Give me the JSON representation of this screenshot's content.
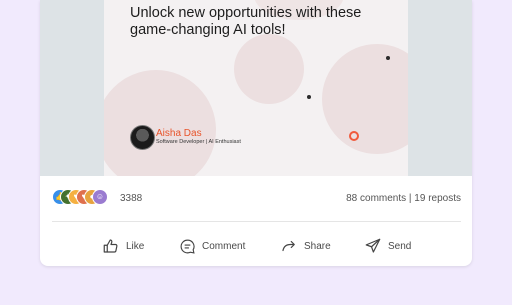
{
  "post": {
    "headline": "Unlock new opportunities with these game-changing AI tools!",
    "author": {
      "name": "Aisha Das",
      "role": "Software Developer | AI Enthusiast"
    }
  },
  "stats": {
    "reaction_count": "3388",
    "comments_reposts": "88 comments | 19 reposts",
    "reaction_icons": [
      "like-icon",
      "celebrate-icon",
      "support-icon",
      "love-icon",
      "insightful-icon",
      "funny-icon"
    ]
  },
  "actions": {
    "like": "Like",
    "comment": "Comment",
    "share": "Share",
    "send": "Send"
  },
  "colors": {
    "page_bg": "#f1eafd",
    "author_accent": "#e8542b",
    "hero_bg": "#dde3e6"
  }
}
